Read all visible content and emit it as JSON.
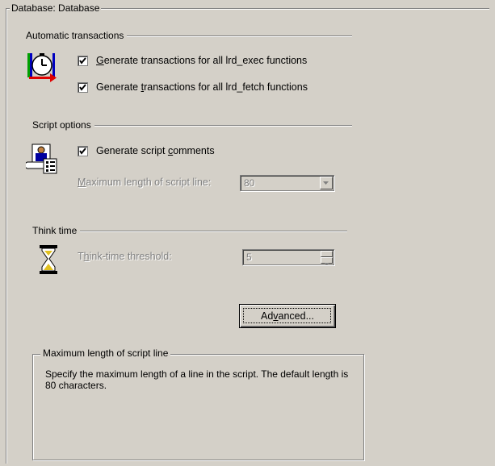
{
  "outer_group": {
    "title": "Database: Database"
  },
  "automatic_transactions": {
    "title": "Automatic transactions",
    "icon": "transaction-clock-icon",
    "options": [
      {
        "label_before": "",
        "label_underlined": "G",
        "label_after": "enerate transactions for all lrd_exec functions",
        "checked": true
      },
      {
        "label_before": "Generate ",
        "label_underlined": "t",
        "label_after": "ransactions for all lrd_fetch functions",
        "checked": true
      }
    ]
  },
  "script_options": {
    "title": "Script options",
    "icon": "script-document-icon",
    "comments": {
      "label_before": "Generate script ",
      "label_underlined": "c",
      "label_after": "omments",
      "checked": true
    },
    "max_length": {
      "label_before": "",
      "label_underlined": "M",
      "label_after": "aximum length of script line:",
      "value": "80",
      "enabled": false
    }
  },
  "think_time": {
    "title": "Think time",
    "icon": "hourglass-icon",
    "threshold": {
      "label_before": "T",
      "label_underlined": "h",
      "label_after": "ink-time threshold:",
      "value": "5",
      "enabled": false
    }
  },
  "advanced_button": {
    "label_before": "Ad",
    "label_underlined": "v",
    "label_after": "anced..."
  },
  "help_box": {
    "title": "Maximum length of script line",
    "text": "Specify the maximum length of a line in the script. The default length is 80 characters."
  },
  "colors": {
    "background": "#d4d0c8",
    "disabled_text": "#808080"
  }
}
